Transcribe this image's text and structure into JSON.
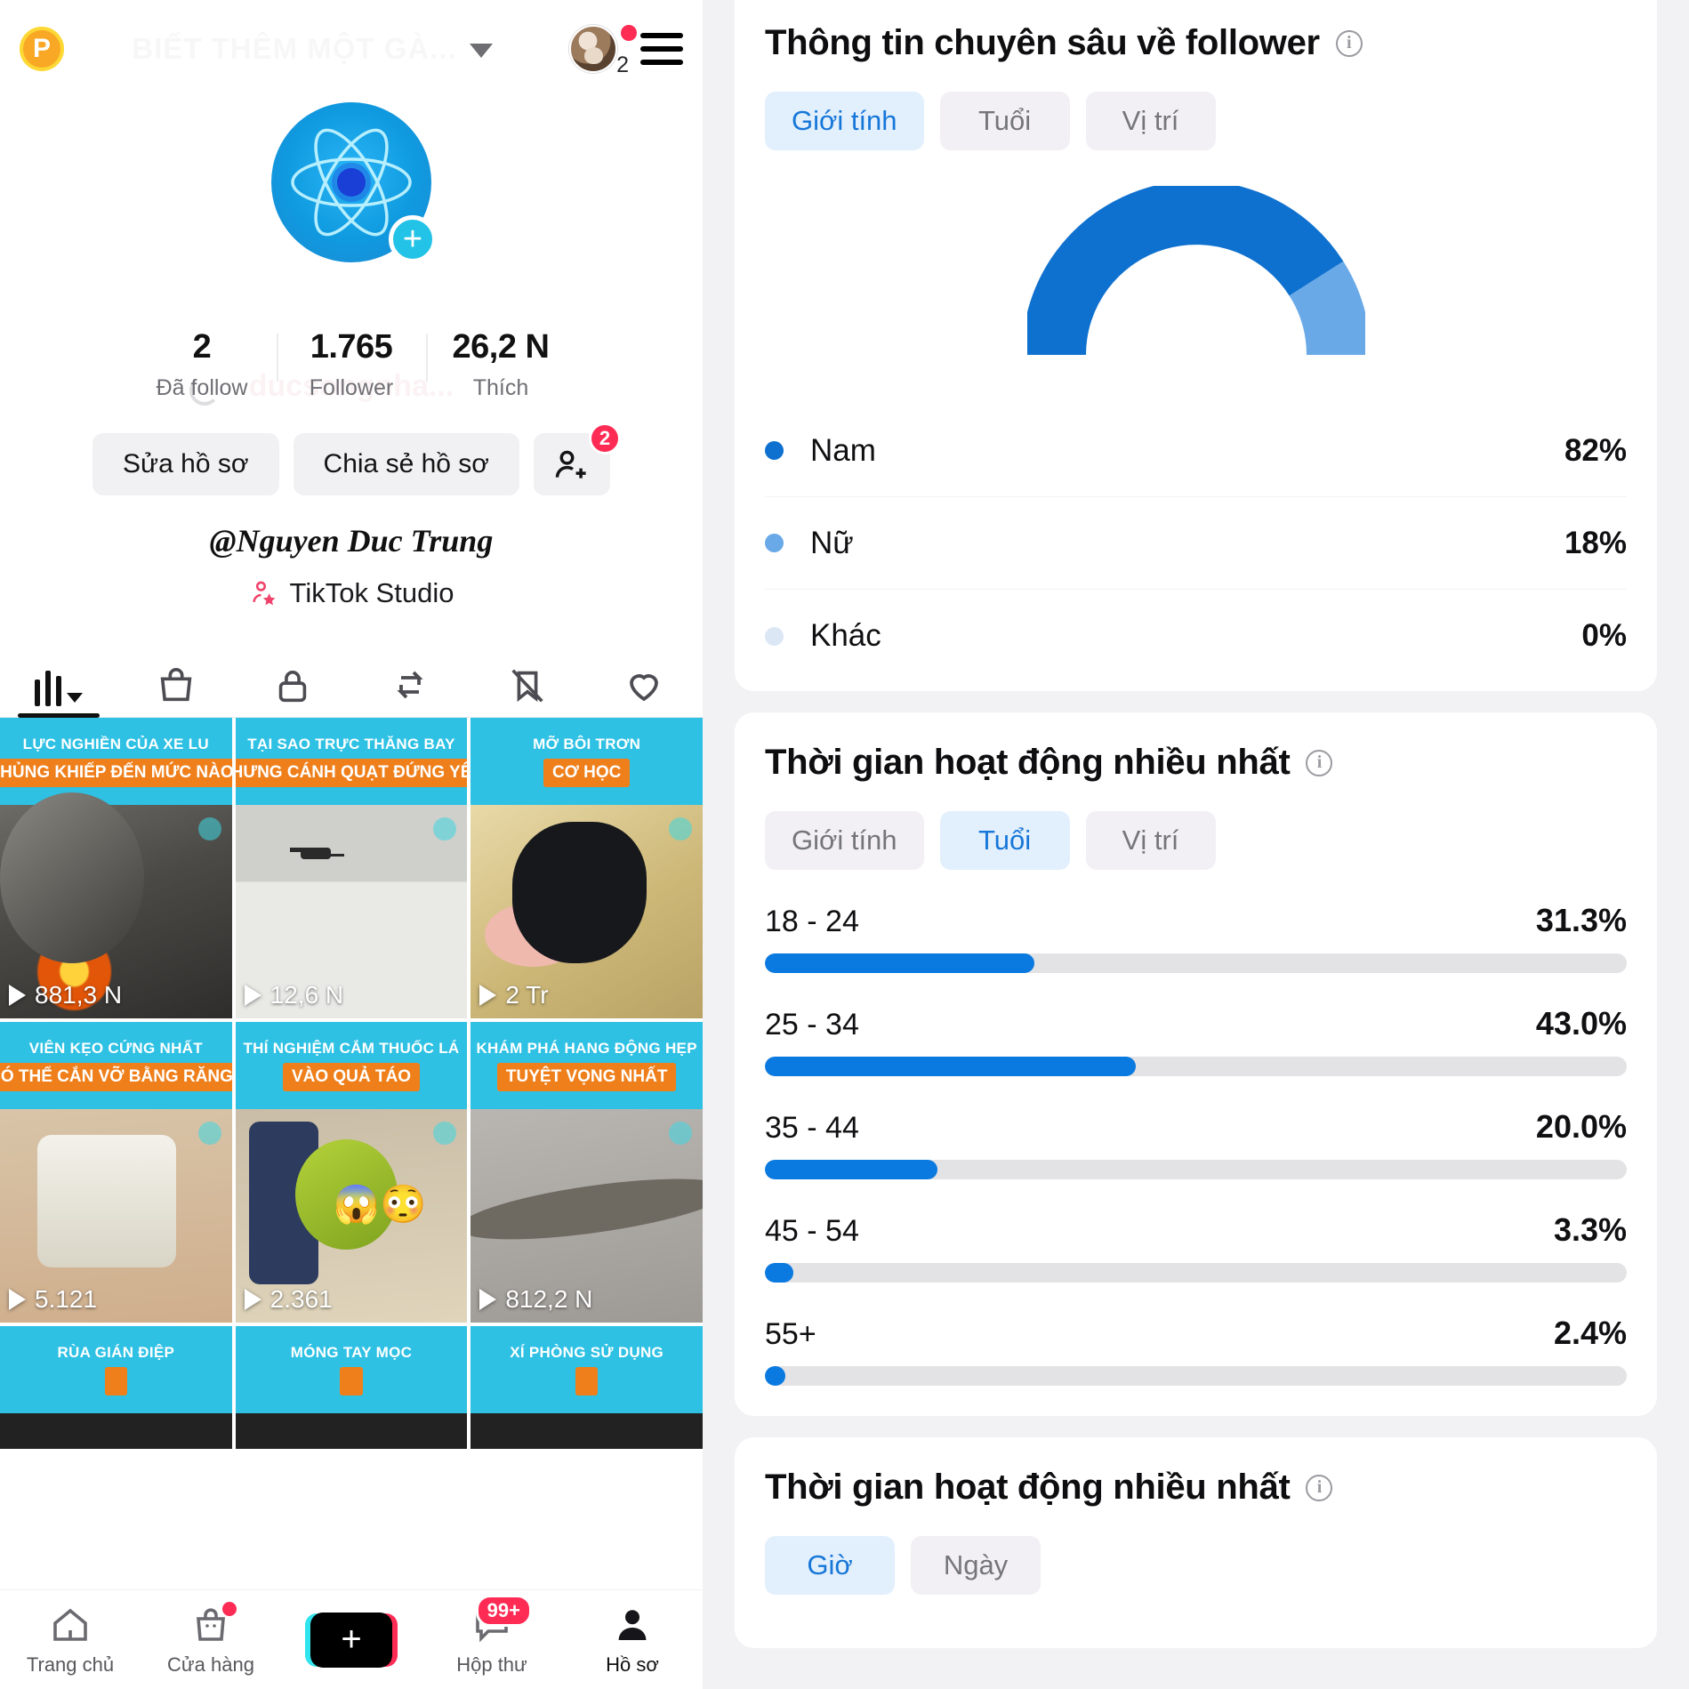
{
  "left": {
    "topbar": {
      "coin_icon": "coin-icon",
      "title": "BIẾT THÊM MỘT GÀ...",
      "chevron_icon": "chevron-down-icon",
      "avatar_icon": "avatar",
      "avatar_count": "2",
      "menu_icon": "hamburger-menu-icon"
    },
    "profile": {
      "avatar_icon": "atom-avatar",
      "add_badge_icon": "plus-icon",
      "faded_display_name": "ducsongnha...",
      "loading_icon": "spinner-icon",
      "stats": [
        {
          "value": "2",
          "label": "Đã follow"
        },
        {
          "value": "1.765",
          "label": "Follower"
        },
        {
          "value": "26,2 N",
          "label": "Thích"
        }
      ],
      "edit_profile_label": "Sửa hồ sơ",
      "share_profile_label": "Chia sẻ hồ sơ",
      "add_friends_icon": "add-person-icon",
      "add_friends_badge": "2",
      "handle": "@Nguyen Duc Trung",
      "studio_icon": "person-star-icon",
      "studio_label": "TikTok Studio"
    },
    "tabs": [
      {
        "name": "videos",
        "icon": "bars-icon",
        "active": true
      },
      {
        "name": "shop",
        "icon": "shopping-bag-icon",
        "active": false
      },
      {
        "name": "private",
        "icon": "lock-icon",
        "active": false
      },
      {
        "name": "reposts",
        "icon": "repost-icon",
        "active": false
      },
      {
        "name": "hidden",
        "icon": "bookmark-slash-icon",
        "active": false
      },
      {
        "name": "liked",
        "icon": "heart-icon",
        "active": false
      }
    ],
    "videos": [
      {
        "cap_top": "LỰC NGHIỀN CỦA XE LU",
        "cap_pill": "KHỦNG KHIẾP ĐẾN MỨC NÀO?",
        "views": "881,3 N",
        "thumb": "t1"
      },
      {
        "cap_top": "TẠI SAO TRỰC THĂNG BAY",
        "cap_pill": "NHƯNG CÁNH QUẠT ĐỨNG YÊN",
        "views": "12,6 N",
        "thumb": "t2"
      },
      {
        "cap_top": "MỠ BÔI TRƠN",
        "cap_pill": "CƠ HỌC",
        "views": "2 Tr",
        "thumb": "t3"
      },
      {
        "cap_top": "VIÊN KẸO CỨNG NHẤT",
        "cap_pill": "CÓ THỂ CẮN VỠ BẰNG RĂNG?",
        "views": "5.121",
        "thumb": "t4"
      },
      {
        "cap_top": "THÍ NGHIỆM CẮM THUỐC LÁ",
        "cap_pill": "VÀO QUẢ TÁO",
        "views": "2.361",
        "thumb": "t5"
      },
      {
        "cap_top": "KHÁM PHÁ HANG ĐỘNG HẸP",
        "cap_pill": "TUYỆT VỌNG NHẤT",
        "views": "812,2 N",
        "thumb": "t6"
      }
    ],
    "videos_partial": [
      {
        "cap_top": "RÙA GIÁN ĐIỆP"
      },
      {
        "cap_top": "MÓNG TAY MỌC"
      },
      {
        "cap_top": "XÍ PHÒNG SỬ DỤNG"
      }
    ],
    "nav": [
      {
        "label": "Trang chủ",
        "icon": "home-icon",
        "active": false,
        "badge": ""
      },
      {
        "label": "Cửa hàng",
        "icon": "shopping-bag-icon",
        "active": false,
        "badge": "dot"
      },
      {
        "label": "",
        "icon": "create-plus-icon",
        "active": false,
        "badge": ""
      },
      {
        "label": "Hộp thư",
        "icon": "inbox-icon",
        "active": false,
        "badge": "99+"
      },
      {
        "label": "Hồ sơ",
        "icon": "person-icon",
        "active": true,
        "badge": ""
      }
    ]
  },
  "right": {
    "cards": [
      {
        "title": "Thông tin chuyên sâu về follower",
        "info_icon": "info-icon",
        "tabs": [
          {
            "label": "Giới tính",
            "active": true
          },
          {
            "label": "Tuổi",
            "active": false
          },
          {
            "label": "Vị trí",
            "active": false
          }
        ]
      },
      {
        "title": "Thời gian hoạt động nhiều nhất",
        "info_icon": "info-icon",
        "tabs": [
          {
            "label": "Giới tính",
            "active": false
          },
          {
            "label": "Tuổi",
            "active": true
          },
          {
            "label": "Vị trí",
            "active": false
          }
        ]
      },
      {
        "title": "Thời gian hoạt động nhiều nhất",
        "info_icon": "info-icon",
        "tabs": [
          {
            "label": "Giờ",
            "active": true
          },
          {
            "label": "Ngày",
            "active": false
          }
        ]
      }
    ],
    "colors": {
      "accent_blue": "#0a7ae0",
      "gauge_dark": "#0f71cf",
      "gauge_light": "#6aa9e8",
      "track_grey": "#e3e3e5",
      "tab_active_bg": "#e2effc",
      "tab_active_text": "#1677d9",
      "badge_red": "#fe2c55"
    }
  },
  "chart_data": [
    {
      "type": "pie",
      "title": "Thông tin chuyên sâu về follower",
      "subtitle": "Giới tính",
      "layout": "semicircle-donut-gauge",
      "legend": "below",
      "labels": [
        "Nam",
        "Nữ",
        "Khác"
      ],
      "values": [
        82,
        18,
        0
      ],
      "value_labels": [
        "82%",
        "18%",
        "0%"
      ],
      "colors": [
        "#0f71cf",
        "#6aa9e8",
        "#dce7f5"
      ]
    },
    {
      "type": "bar",
      "orientation": "horizontal",
      "title": "Thời gian hoạt động nhiều nhất",
      "subtitle": "Tuổi",
      "xlabel": "",
      "ylabel": "",
      "xlim": [
        0,
        100
      ],
      "grid": false,
      "categories": [
        "18 - 24",
        "25 - 34",
        "35 - 44",
        "45 - 54",
        "55+"
      ],
      "values": [
        31.3,
        43.0,
        20.0,
        3.3,
        2.4
      ],
      "value_labels": [
        "31.3%",
        "43.0%",
        "20.0%",
        "3.3%",
        "2.4%"
      ],
      "bar_color": "#0a7ae0",
      "track_color": "#e3e3e5"
    }
  ]
}
